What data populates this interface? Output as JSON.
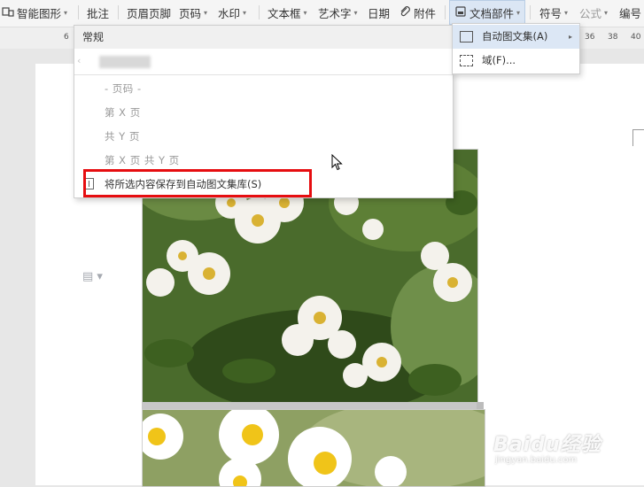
{
  "ribbon": {
    "smart_shape": "智能图形",
    "comment": "批注",
    "header_footer": "页眉页脚",
    "page_number": "页码",
    "watermark": "水印",
    "text_box": "文本框",
    "word_art": "艺术字",
    "date": "日期",
    "attachment": "附件",
    "doc_parts": "文档部件",
    "symbol": "符号",
    "formula": "公式",
    "numbering": "编号"
  },
  "ruler": {
    "left_mark": "6",
    "marks": [
      "36",
      "38",
      "40"
    ]
  },
  "menu": {
    "header": "常规",
    "items": [
      "- 页码 -",
      "第 X 页",
      "共 Y 页",
      "第 X 页 共 Y 页"
    ],
    "save_label": "将所选内容保存到自动图文集库(S)"
  },
  "submenu": {
    "autotext_label": "自动图文集(A)",
    "field_label": "域(F)..."
  },
  "watermark": {
    "main": "Baidu经验",
    "sub": "jingyan.baidu.com"
  },
  "colors": {
    "highlight_box": "#e60d10",
    "submenu_highlight": "#dce7f5"
  }
}
